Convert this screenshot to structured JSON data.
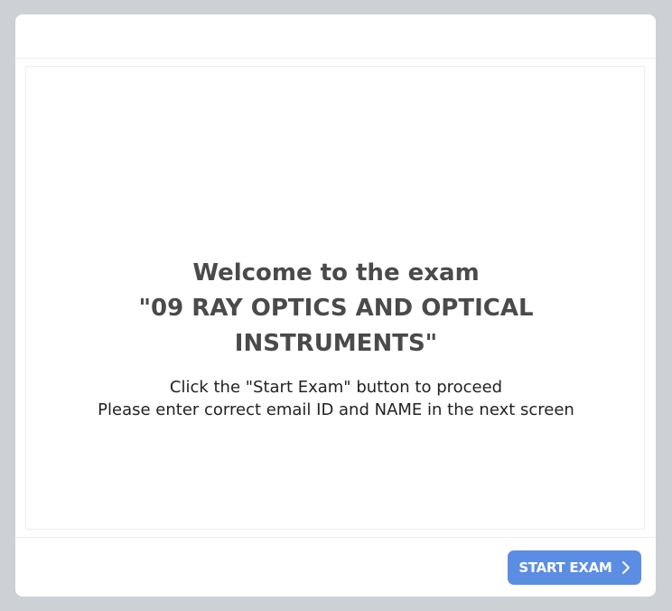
{
  "exam": {
    "welcome_line": "Welcome to the exam",
    "title_line": "\"09 RAY OPTICS AND OPTICAL INSTRUMENTS\"",
    "instruction_1": "Click the \"Start Exam\" button to proceed",
    "instruction_2": "Please enter correct email ID and NAME in the next screen"
  },
  "footer": {
    "start_label": "START EXAM",
    "start_icon": "chevron-right-icon"
  },
  "colors": {
    "page_background": "#cdd0d4",
    "card_background": "#ffffff",
    "button_background": "#5b8de2",
    "heading_text": "#4a4a4a"
  }
}
